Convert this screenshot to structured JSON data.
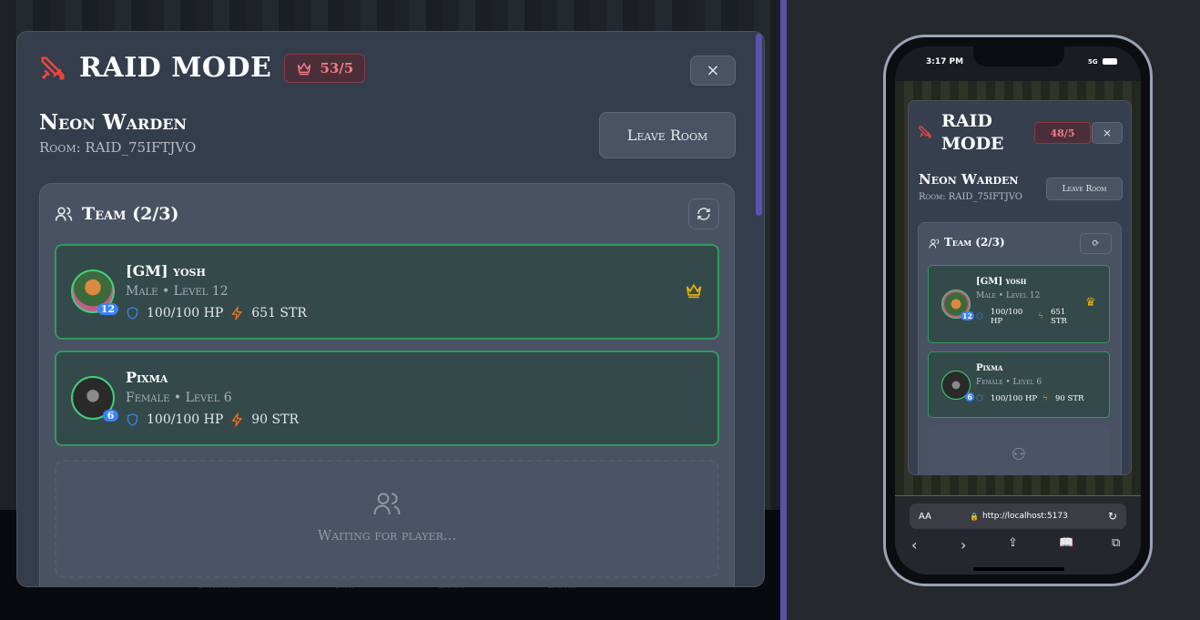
{
  "background_nav": [
    "Inventory",
    "Shop",
    "Games",
    "Battle"
  ],
  "modal": {
    "title": "RAID MODE",
    "raid_count": "53/5",
    "close": "×",
    "character": "Neon Warden",
    "room": "Room: RAID_75IFTJVO",
    "leave": "Leave Room",
    "team": {
      "header": "Team (2/3)",
      "players": [
        {
          "name": "[GM] yosh",
          "meta": "Male • Level 12",
          "level": "12",
          "hp": "100/100 HP",
          "str": "651 STR",
          "leader": true
        },
        {
          "name": "Pixma",
          "meta": "Female • Level 6",
          "level": "6",
          "hp": "100/100 HP",
          "str": "90 STR",
          "leader": false
        }
      ],
      "waiting": "Waiting for player..."
    }
  },
  "phone": {
    "time": "3:17 PM",
    "network": "5G",
    "title_line1": "RAID",
    "title_line2": "MODE",
    "raid_count": "48/5",
    "close": "×",
    "character": "Neon Warden",
    "room": "Room: RAID_75IFTJVO",
    "leave": "Leave Room",
    "team_header": "Team (2/3)",
    "players": [
      {
        "name": "[GM] yosh",
        "meta": "Male • Level 12",
        "level": "12",
        "hp": "100/100 HP",
        "str": "651 STR"
      },
      {
        "name": "Pixma",
        "meta": "Female • Level 6",
        "level": "6",
        "hp": "100/100 HP",
        "str": "90 STR"
      }
    ],
    "browser": {
      "text_size": "AA",
      "url": "http://localhost:5173"
    }
  },
  "colors": {
    "accent_red": "#ef4444",
    "accent_green": "#2f9a5a",
    "gold": "#eab308",
    "hp_blue": "#3b82f6",
    "str_orange": "#f97316"
  }
}
